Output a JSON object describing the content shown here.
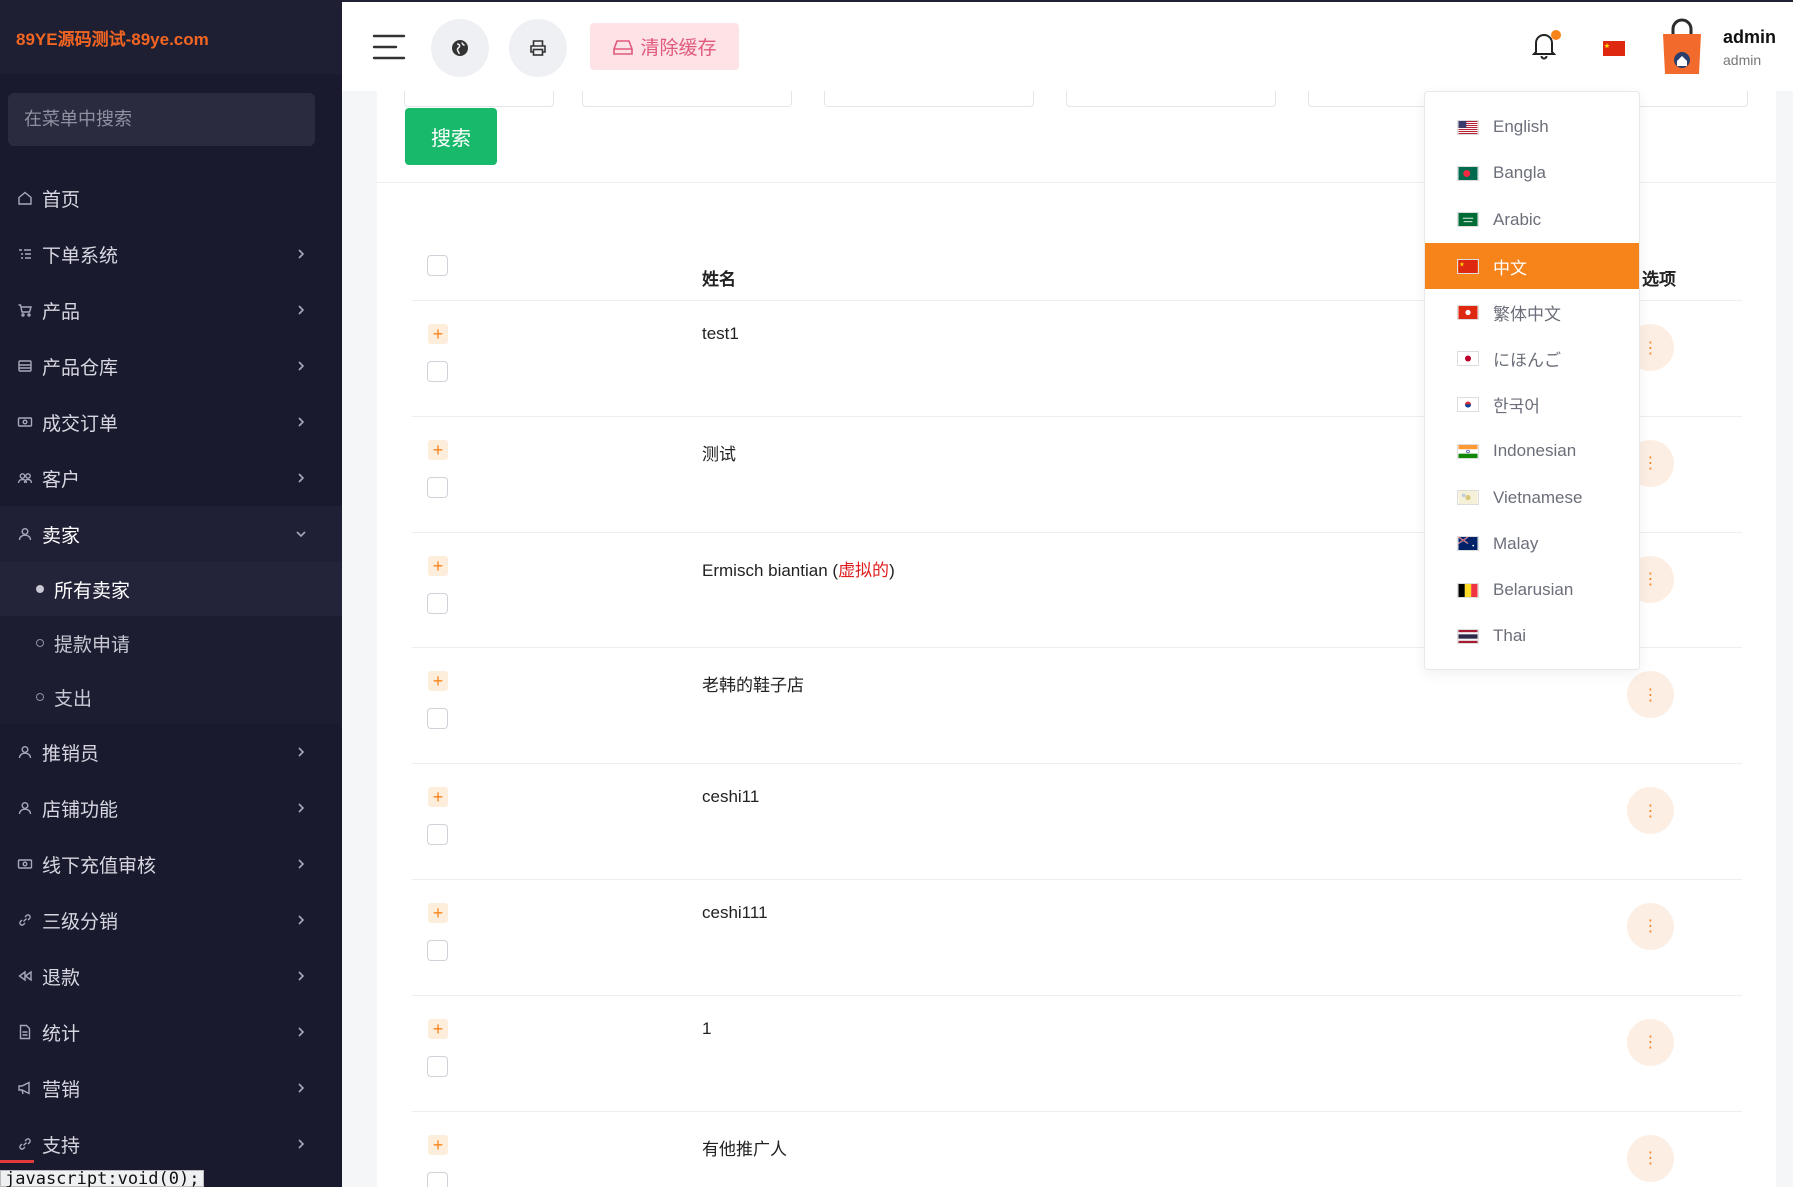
{
  "brand": "89YE源码测试-89ye.com",
  "sidebar": {
    "search_placeholder": "在菜单中搜索",
    "items": [
      {
        "label": "首页"
      },
      {
        "label": "下单系统"
      },
      {
        "label": "产品"
      },
      {
        "label": "产品仓库"
      },
      {
        "label": "成交订单"
      },
      {
        "label": "客户"
      },
      {
        "label": "卖家"
      },
      {
        "label": "推销员"
      },
      {
        "label": "店铺功能"
      },
      {
        "label": "线下充值审核"
      },
      {
        "label": "三级分销"
      },
      {
        "label": "退款"
      },
      {
        "label": "统计"
      },
      {
        "label": "营销"
      },
      {
        "label": "支持"
      }
    ],
    "seller_sub": [
      {
        "label": "所有卖家"
      },
      {
        "label": "提款申请"
      },
      {
        "label": "支出"
      }
    ]
  },
  "status_tip": "javascript:void(0);",
  "topbar": {
    "clear_cache": "清除缓存",
    "user_name": "admin",
    "user_role": "admin"
  },
  "main": {
    "search_button": "搜索",
    "columns": {
      "name": "姓名",
      "options": "选项"
    },
    "rows": [
      {
        "name": "test1"
      },
      {
        "name": "测试"
      },
      {
        "name": "Ermisch biantian (",
        "badge": "虚拟的",
        "suffix": ")"
      },
      {
        "name": "老韩的鞋子店"
      },
      {
        "name": "ceshi11"
      },
      {
        "name": "ceshi111"
      },
      {
        "name": "1"
      },
      {
        "name": "有他推广人"
      }
    ]
  },
  "languages": [
    {
      "label": "English",
      "icon": "flag-us"
    },
    {
      "label": "Bangla",
      "icon": "flag-bd"
    },
    {
      "label": "Arabic",
      "icon": "flag-sa"
    },
    {
      "label": "中文",
      "icon": "flag-cn",
      "active": true
    },
    {
      "label": "繁体中文",
      "icon": "flag-hk"
    },
    {
      "label": "にほんご",
      "icon": "flag-jp"
    },
    {
      "label": "한국어",
      "icon": "flag-kr"
    },
    {
      "label": "Indonesian",
      "icon": "flag-in"
    },
    {
      "label": "Vietnamese",
      "icon": "flag-vn"
    },
    {
      "label": "Malay",
      "icon": "flag-my"
    },
    {
      "label": "Belarusian",
      "icon": "flag-be"
    },
    {
      "label": "Thai",
      "icon": "flag-th"
    }
  ],
  "colors": {
    "accent": "#f7831b",
    "sidebar_bg": "#191a2e",
    "search_green": "#19b96c",
    "clear_pink": "#fde2e6"
  }
}
